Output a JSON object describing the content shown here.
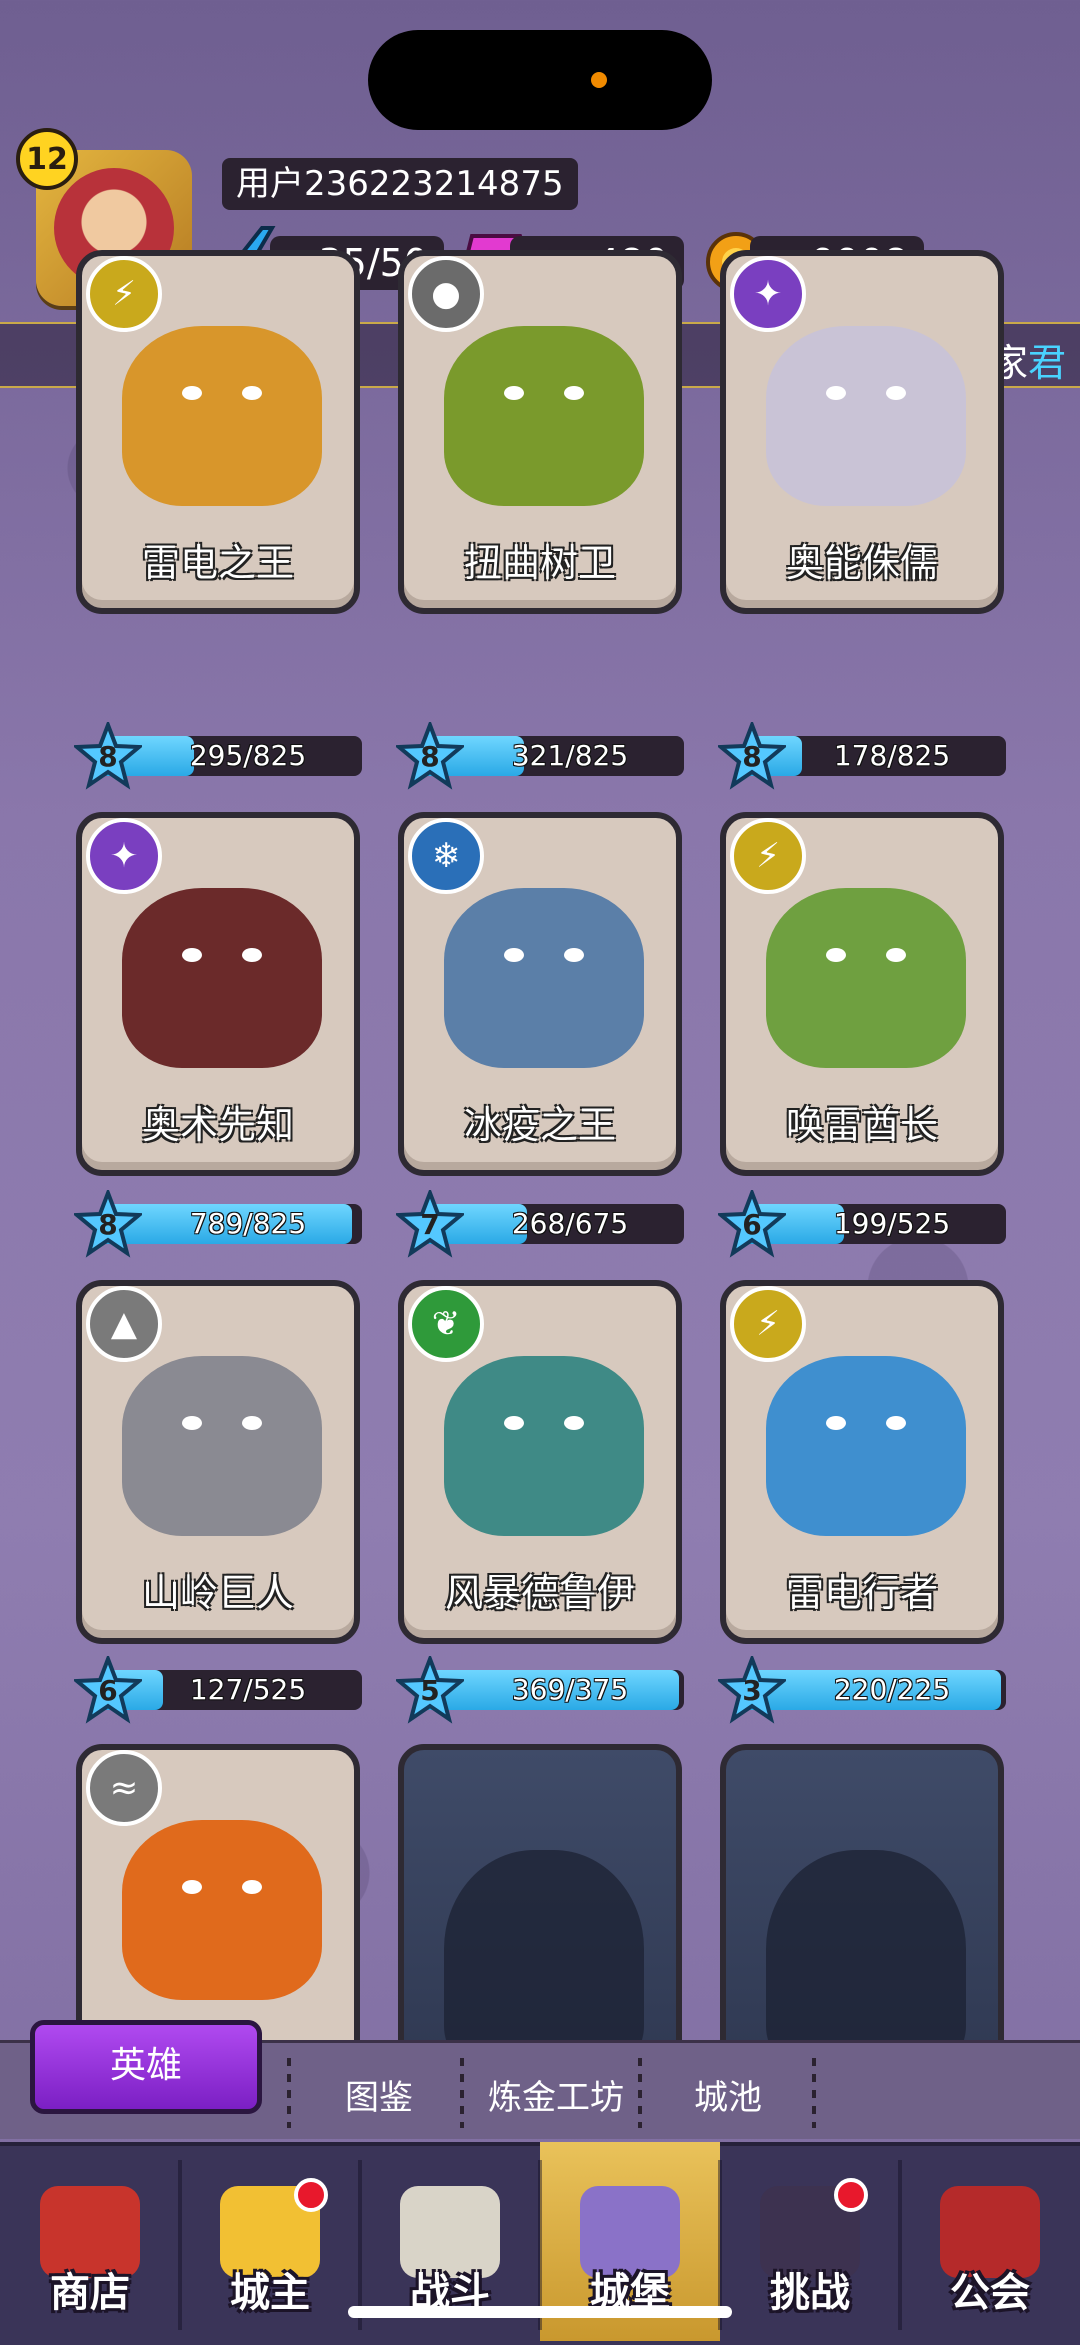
{
  "profile": {
    "level": "12",
    "username": "用户236223214875"
  },
  "resources": {
    "energy": "35/50",
    "gems": "480",
    "gold": "9908"
  },
  "marquee": {
    "prefix": "玩家",
    "highlight": "君"
  },
  "heroes": [
    {
      "name": "雷电之王",
      "stars": "8",
      "progress": "295/825",
      "fill": 0.36,
      "element": "lightning",
      "badge_color": "#c9a91c",
      "body_color": "#d8962b"
    },
    {
      "name": "扭曲树卫",
      "stars": "8",
      "progress": "321/825",
      "fill": 0.39,
      "element": "neutral",
      "badge_color": "#6b6b6b",
      "body_color": "#7a9a2c"
    },
    {
      "name": "奥能侏儒",
      "stars": "8",
      "progress": "178/825",
      "fill": 0.22,
      "element": "arcane",
      "badge_color": "#7a3fc0",
      "body_color": "#c9c3d6"
    },
    {
      "name": "奥术先知",
      "stars": "8",
      "progress": "789/825",
      "fill": 0.96,
      "element": "arcane",
      "badge_color": "#7a3fc0",
      "body_color": "#6b2a2a"
    },
    {
      "name": "冰疫之王",
      "stars": "7",
      "progress": "268/675",
      "fill": 0.4,
      "element": "ice",
      "badge_color": "#2a6fb8",
      "body_color": "#5b7fa8"
    },
    {
      "name": "唤雷酋长",
      "stars": "6",
      "progress": "199/525",
      "fill": 0.38,
      "element": "lightning",
      "badge_color": "#c9a91c",
      "body_color": "#6fa040"
    },
    {
      "name": "山岭巨人",
      "stars": "6",
      "progress": "127/525",
      "fill": 0.24,
      "element": "earth",
      "badge_color": "#7a7a7a",
      "body_color": "#8a8a92"
    },
    {
      "name": "风暴德鲁伊",
      "stars": "5",
      "progress": "369/375",
      "fill": 0.98,
      "element": "nature",
      "badge_color": "#2f9a3a",
      "body_color": "#3f8a86"
    },
    {
      "name": "雷电行者",
      "stars": "3",
      "progress": "220/225",
      "fill": 0.98,
      "element": "lightning",
      "badge_color": "#c9a91c",
      "body_color": "#3f8fcf"
    },
    {
      "name": "",
      "element": "wind",
      "badge_color": "#7a7a7a",
      "body_color": "#e06a1c"
    }
  ],
  "subtabs": {
    "active": "英雄",
    "items": [
      "图鉴",
      "炼金工坊",
      "城池"
    ]
  },
  "nav": {
    "items": [
      "商店",
      "城主",
      "战斗",
      "城堡",
      "挑战",
      "公会"
    ],
    "active": "城堡"
  }
}
